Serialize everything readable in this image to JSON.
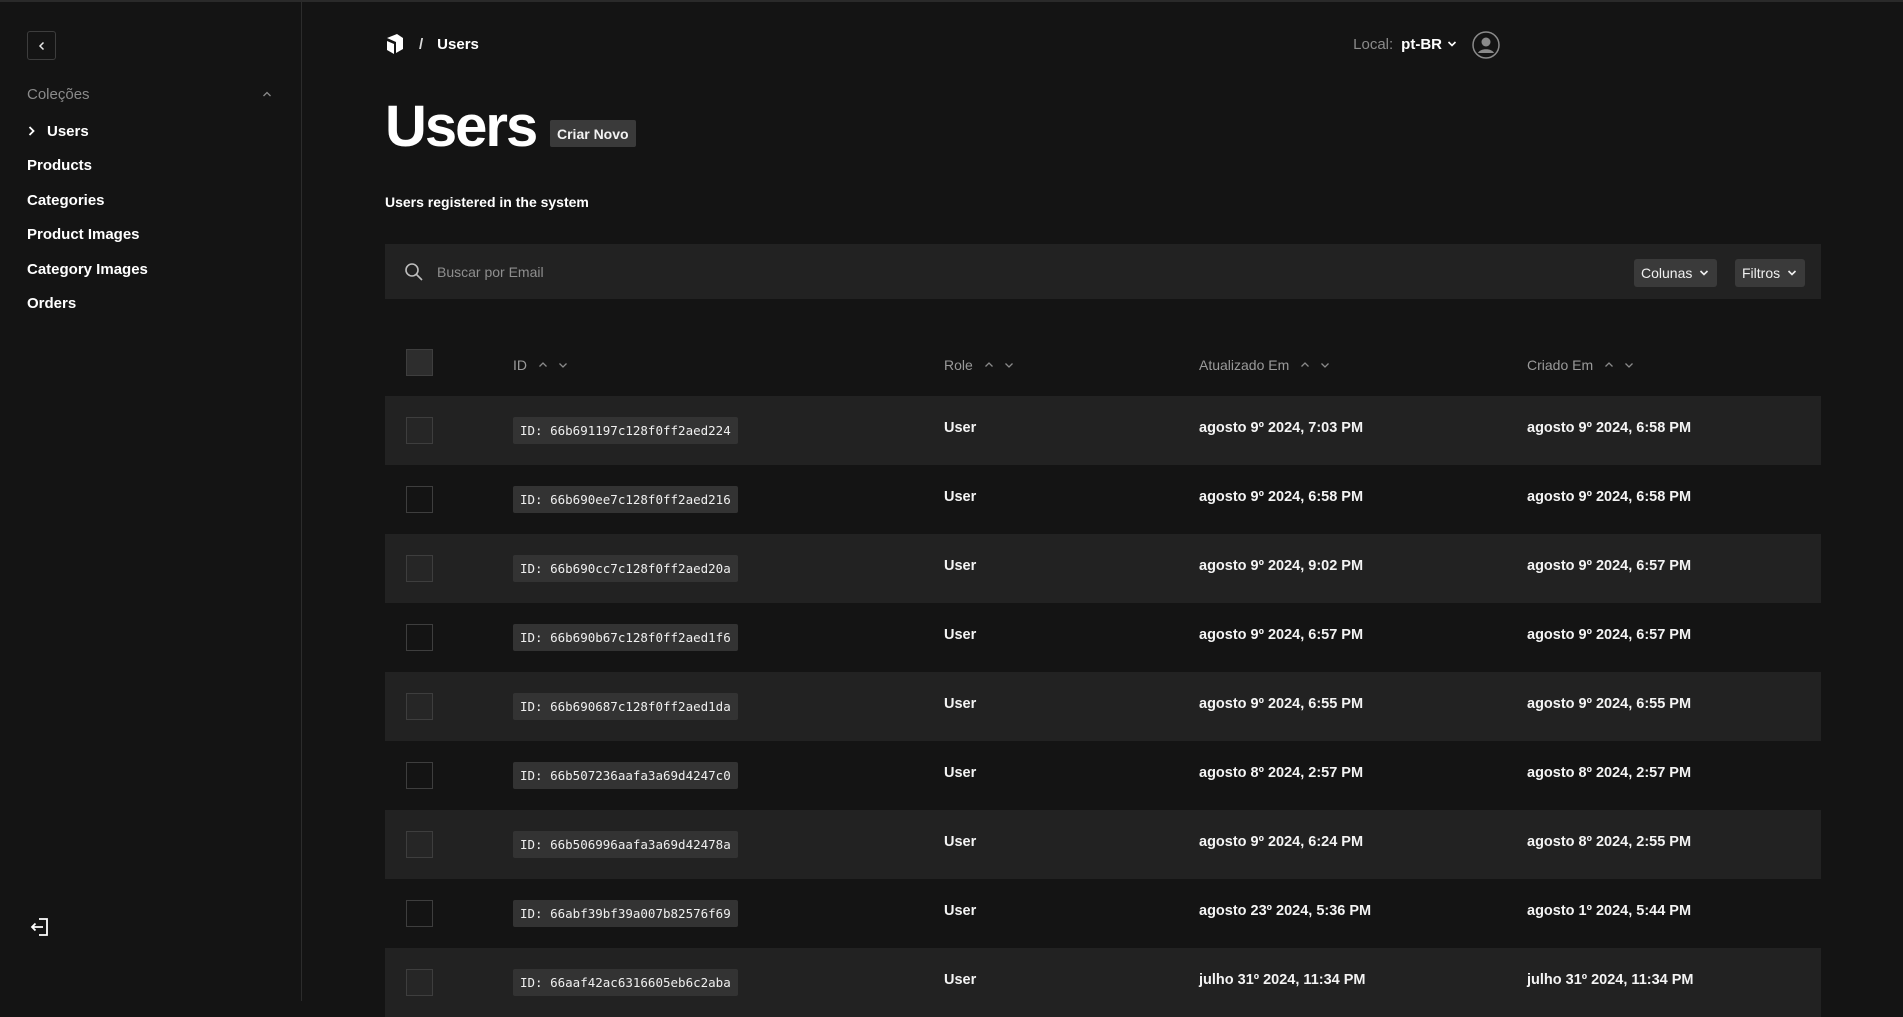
{
  "sidebar": {
    "section_label": "Coleções",
    "items": [
      {
        "label": "Users",
        "active": true
      },
      {
        "label": "Products"
      },
      {
        "label": "Categories"
      },
      {
        "label": "Product Images"
      },
      {
        "label": "Category Images"
      },
      {
        "label": "Orders"
      }
    ]
  },
  "header": {
    "breadcrumb_separator": "/",
    "breadcrumb_current": "Users",
    "locale_label": "Local:",
    "locale_value": "pt-BR"
  },
  "page": {
    "title": "Users",
    "create_label": "Criar Novo",
    "description": "Users registered in the system"
  },
  "search": {
    "placeholder": "Buscar por Email",
    "columns_label": "Colunas",
    "filters_label": "Filtros"
  },
  "table": {
    "columns": [
      "ID",
      "Role",
      "Atualizado Em",
      "Criado Em"
    ],
    "rows": [
      {
        "id": "ID: 66b691197c128f0ff2aed224",
        "role": "User",
        "updated": "agosto 9º 2024, 7:03 PM",
        "created": "agosto 9º 2024, 6:58 PM"
      },
      {
        "id": "ID: 66b690ee7c128f0ff2aed216",
        "role": "User",
        "updated": "agosto 9º 2024, 6:58 PM",
        "created": "agosto 9º 2024, 6:58 PM"
      },
      {
        "id": "ID: 66b690cc7c128f0ff2aed20a",
        "role": "User",
        "updated": "agosto 9º 2024, 9:02 PM",
        "created": "agosto 9º 2024, 6:57 PM"
      },
      {
        "id": "ID: 66b690b67c128f0ff2aed1f6",
        "role": "User",
        "updated": "agosto 9º 2024, 6:57 PM",
        "created": "agosto 9º 2024, 6:57 PM"
      },
      {
        "id": "ID: 66b690687c128f0ff2aed1da",
        "role": "User",
        "updated": "agosto 9º 2024, 6:55 PM",
        "created": "agosto 9º 2024, 6:55 PM"
      },
      {
        "id": "ID: 66b507236aafa3a69d4247c0",
        "role": "User",
        "updated": "agosto 8º 2024, 2:57 PM",
        "created": "agosto 8º 2024, 2:57 PM"
      },
      {
        "id": "ID: 66b506996aafa3a69d42478a",
        "role": "User",
        "updated": "agosto 9º 2024, 6:24 PM",
        "created": "agosto 8º 2024, 2:55 PM"
      },
      {
        "id": "ID: 66abf39bf39a007b82576f69",
        "role": "User",
        "updated": "agosto 23º 2024, 5:36 PM",
        "created": "agosto 1º 2024, 5:44 PM"
      },
      {
        "id": "ID: 66aaf42ac6316605eb6c2aba",
        "role": "User",
        "updated": "julho 31º 2024, 11:34 PM",
        "created": "julho 31º 2024, 11:34 PM"
      }
    ]
  },
  "icons": {
    "collapse": "chevron-left-icon",
    "section_toggle": "chevron-up-icon",
    "active_marker": "chevron-right-icon",
    "logout": "logout-icon",
    "logo": "payload-logo-icon",
    "search": "search-icon",
    "avatar": "user-avatar-icon"
  },
  "colors": {
    "background": "#141414",
    "row_alt": "#222222",
    "chip": "#333333",
    "button": "#3a3a3a"
  }
}
